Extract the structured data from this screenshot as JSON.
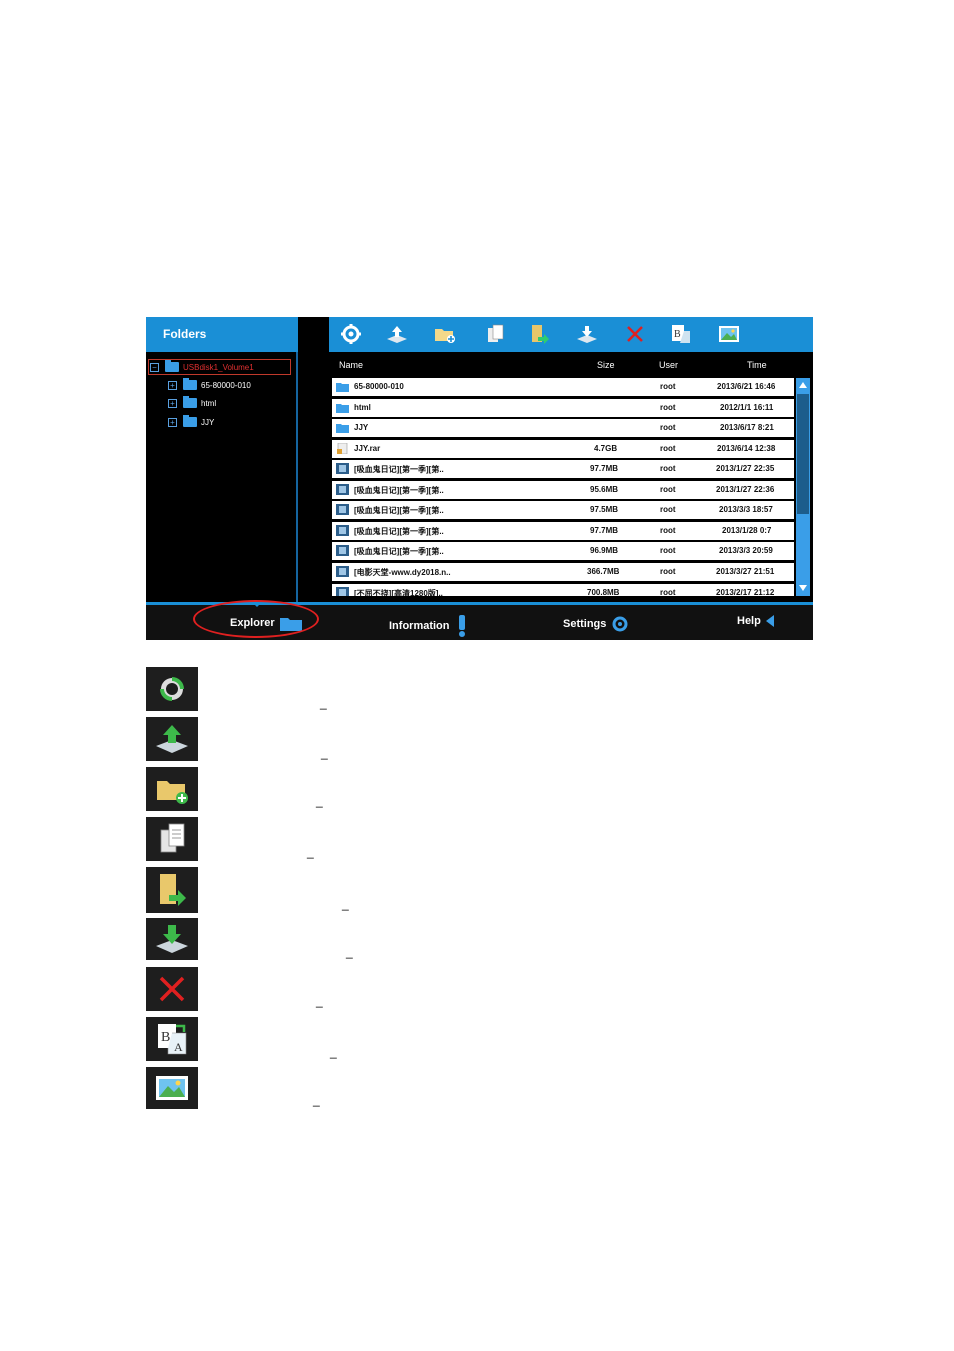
{
  "folders": {
    "header": "Folders",
    "tree": [
      {
        "label": "USBdisk1_Volume1",
        "toggle": "−",
        "selected": true
      },
      {
        "label": "65-80000-010",
        "toggle": "+"
      },
      {
        "label": "html",
        "toggle": "+"
      },
      {
        "label": "JJY",
        "toggle": "+"
      }
    ]
  },
  "toolbar": {
    "icons": [
      "refresh-icon",
      "upload-icon",
      "new-folder-icon",
      "copy-icon",
      "move-icon",
      "download-icon",
      "delete-icon",
      "rename-icon",
      "preview-icon"
    ]
  },
  "table": {
    "columns": {
      "name": "Name",
      "size": "Size",
      "user": "User",
      "time": "Time"
    },
    "rows": [
      {
        "type": "folder",
        "name": "65-80000-010",
        "size": "",
        "user": "root",
        "time": "2013/6/21 16:46"
      },
      {
        "type": "folder",
        "name": "html",
        "size": "",
        "user": "root",
        "time": "2012/1/1 16:11"
      },
      {
        "type": "folder",
        "name": "JJY",
        "size": "",
        "user": "root",
        "time": "2013/6/17 8:21"
      },
      {
        "type": "archive",
        "name": "JJY.rar",
        "size": "4.7GB",
        "user": "root",
        "time": "2013/6/14 12:38"
      },
      {
        "type": "video",
        "name": "[吸血鬼日记][第一季][第..",
        "size": "97.7MB",
        "user": "root",
        "time": "2013/1/27 22:35"
      },
      {
        "type": "video",
        "name": "[吸血鬼日记][第一季][第..",
        "size": "95.6MB",
        "user": "root",
        "time": "2013/1/27 22:36"
      },
      {
        "type": "video",
        "name": "[吸血鬼日记][第一季][第..",
        "size": "97.5MB",
        "user": "root",
        "time": "2013/3/3 18:57"
      },
      {
        "type": "video",
        "name": "[吸血鬼日记][第一季][第..",
        "size": "97.7MB",
        "user": "root",
        "time": "2013/1/28 0:7"
      },
      {
        "type": "video",
        "name": "[吸血鬼日记][第一季][第..",
        "size": "96.9MB",
        "user": "root",
        "time": "2013/3/3 20:59"
      },
      {
        "type": "video",
        "name": "[电影天堂-www.dy2018.n..",
        "size": "366.7MB",
        "user": "root",
        "time": "2013/3/27 21:51"
      },
      {
        "type": "video",
        "name": "[不屈不挠][高清1280版]..",
        "size": "700.8MB",
        "user": "root",
        "time": "2013/2/17 21:12"
      }
    ]
  },
  "nav": {
    "explorer": "Explorer",
    "information": "Information",
    "settings": "Settings",
    "help": "Help"
  },
  "legend": {
    "icons": [
      "refresh-icon",
      "upload-icon",
      "new-folder-icon",
      "copy-icon",
      "move-icon",
      "download-icon",
      "delete-icon",
      "rename-icon",
      "preview-icon"
    ],
    "dash": "_"
  },
  "colors": {
    "accent": "#1a8fd6",
    "highlight": "#e02020"
  }
}
